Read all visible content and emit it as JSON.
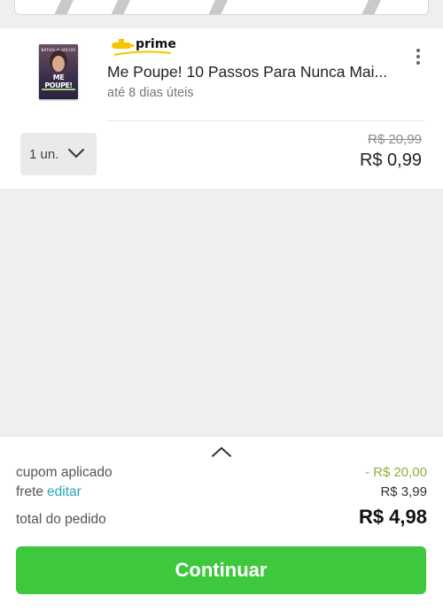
{
  "item": {
    "book_cover_author": "NATHALIA ARCURI",
    "book_cover_title": "ME POUPE!",
    "prime_label": "prime",
    "title": "Me Poupe! 10 Passos Para Nunca Mai...",
    "delivery": "até 8 dias úteis",
    "quantity": "1 un.",
    "old_price": "R$ 20,99",
    "price": "R$ 0,99"
  },
  "summary": {
    "coupon_label": "cupom aplicado",
    "coupon_value": "- R$ 20,00",
    "shipping_label": "frete",
    "shipping_edit": "editar",
    "shipping_value": "R$ 3,99",
    "total_label": "total do pedido",
    "total_value": "R$ 4,98",
    "continue_label": "Continuar"
  },
  "colors": {
    "accent_green": "#3ec83e",
    "coupon_green": "#8ab13a",
    "link_teal": "#2aa7b8",
    "prime_yellow": "#f6c500"
  },
  "icons": [
    "submarine-icon",
    "kebab-menu-icon",
    "chevron-down-icon",
    "chevron-up-icon"
  ]
}
